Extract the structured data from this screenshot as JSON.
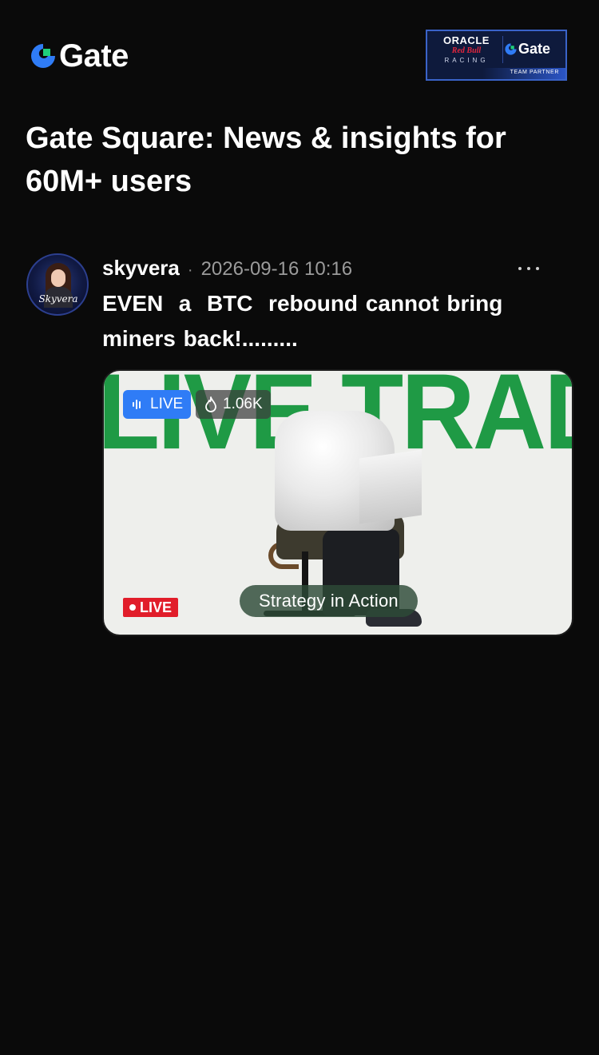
{
  "header": {
    "brand_name": "Gate",
    "partner_badge": {
      "oracle": "ORACLE",
      "redbull": "Red Bull",
      "racing": "RACING",
      "gate": "Gate",
      "team_partner": "TEAM PARTNER"
    }
  },
  "headline": "Gate Square: News & insights for 60M+ users",
  "post": {
    "author": "skyvera",
    "avatar_signature": "Skyvera",
    "timestamp": "2026-09-16 10:16",
    "text": "EVEN  a  BTC  rebound cannot bring miners back!.........",
    "card": {
      "banner_text": "LIVE TRADING",
      "live_badge": "LIVE",
      "views": "1.06K",
      "caption": "Strategy in Action",
      "corner_live": "LIVE"
    }
  },
  "colors": {
    "background": "#0a0a0a",
    "brand_blue": "#2f7cf6",
    "brand_green": "#1f9a45",
    "live_red": "#e11d2a"
  },
  "icons": {
    "brand": "gate-logo-icon",
    "more": "more-dots-icon",
    "live": "live-bars-icon",
    "views": "fire-icon"
  }
}
